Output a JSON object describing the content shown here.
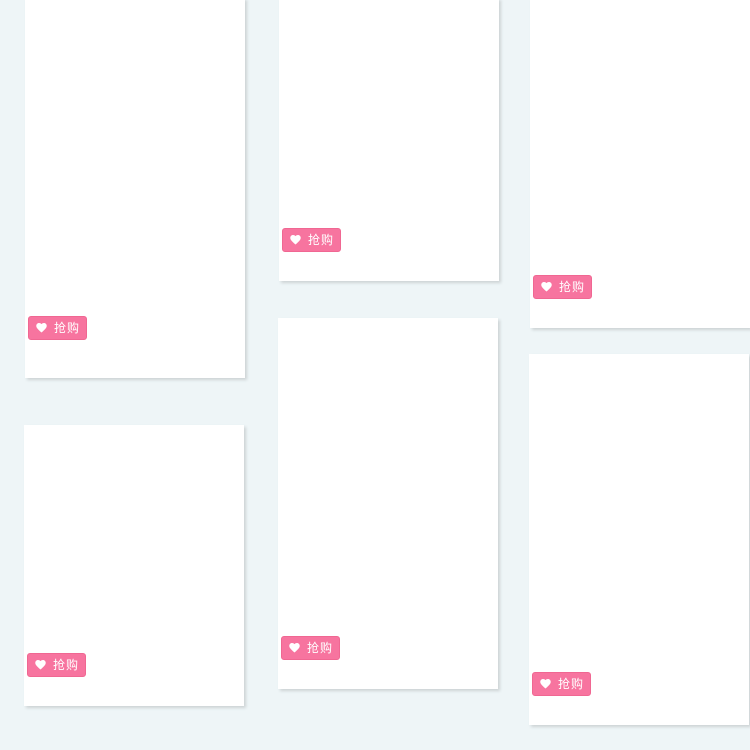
{
  "theme": {
    "background": "#eef5f7",
    "card": "#ffffff",
    "accent": "#f7749f"
  },
  "cards": [
    {
      "buy_label": "抢购",
      "icon": "heart-icon"
    },
    {
      "buy_label": "抢购",
      "icon": "heart-icon"
    },
    {
      "buy_label": "抢购",
      "icon": "heart-icon"
    },
    {
      "buy_label": "抢购",
      "icon": "heart-icon"
    },
    {
      "buy_label": "抢购",
      "icon": "heart-icon"
    },
    {
      "buy_label": "抢购",
      "icon": "heart-icon"
    }
  ]
}
